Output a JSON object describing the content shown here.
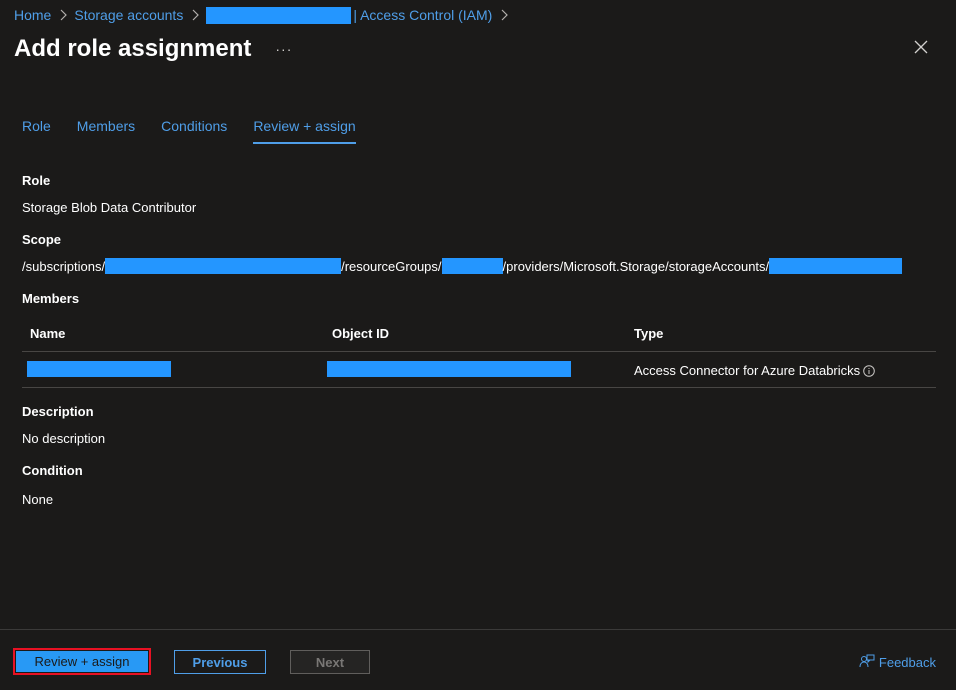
{
  "breadcrumb": {
    "home": "Home",
    "storage_accounts": "Storage accounts",
    "access_control": "| Access Control (IAM)"
  },
  "header": {
    "title": "Add role assignment",
    "more": "···"
  },
  "tabs": [
    {
      "label": "Role"
    },
    {
      "label": "Members"
    },
    {
      "label": "Conditions"
    },
    {
      "label": "Review + assign"
    }
  ],
  "review": {
    "role_label": "Role",
    "role_value": "Storage Blob Data Contributor",
    "scope_label": "Scope",
    "scope_parts": [
      "/subscriptions/",
      "/resourceGroups/",
      "/providers/Microsoft.Storage/storageAccounts/"
    ],
    "members_label": "Members",
    "members_columns": [
      "Name",
      "Object ID",
      "Type"
    ],
    "members_rows": [
      {
        "type": "Access Connector for Azure Databricks"
      }
    ],
    "description_label": "Description",
    "description_value": "No description",
    "condition_label": "Condition",
    "condition_value": "None"
  },
  "footer": {
    "review_assign": "Review + assign",
    "previous": "Previous",
    "next": "Next",
    "feedback": "Feedback"
  },
  "colors": {
    "background": "#1b1a19",
    "link": "#4f9ee8",
    "primary_button": "#2899f5",
    "redaction": "#2496ff",
    "highlight_border": "#e81123"
  }
}
